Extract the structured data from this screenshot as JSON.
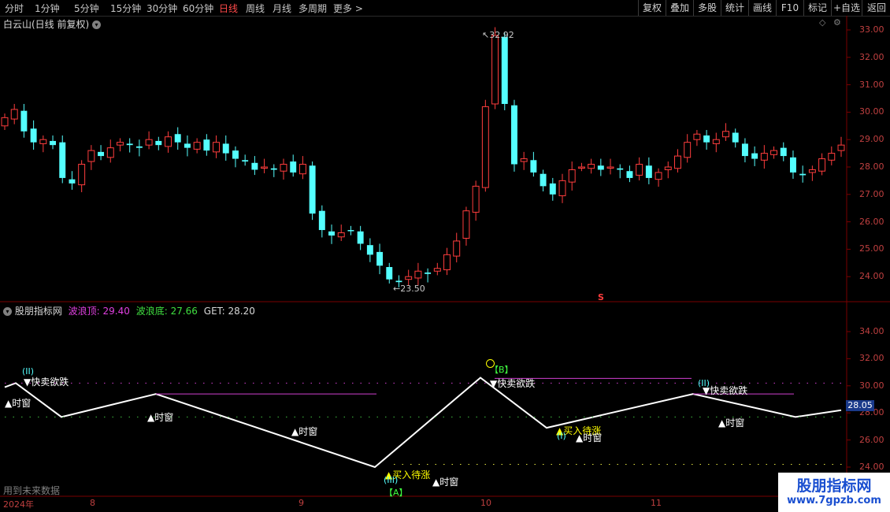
{
  "toolbar": {
    "periods": [
      "分时",
      "1分钟",
      "5分钟",
      "15分钟",
      "30分钟",
      "60分钟",
      "日线",
      "周线",
      "月线",
      "多周期",
      "更多 >"
    ],
    "active_period": "日线",
    "actions": [
      "复权",
      "叠加",
      "多股",
      "统计",
      "画线",
      "F10",
      "标记",
      "+自选",
      "返回"
    ]
  },
  "main_panel": {
    "stock_title": "白云山(日线 前复权)",
    "high_label": "32.92",
    "low_label": "23.50",
    "marker": "S",
    "y_ticks": [
      "33.00",
      "32.00",
      "31.00",
      "30.00",
      "29.00",
      "28.00",
      "27.00",
      "26.00",
      "25.00",
      "24.00"
    ]
  },
  "indicator_panel": {
    "name": "股朋指标网",
    "wave_top_label": "波浪顶: 29.40",
    "wave_bottom_label": "波浪底: 27.66",
    "get_label": "GET: 28.20",
    "y_ticks": [
      "34.00",
      "32.00",
      "30.00",
      "28.00",
      "26.00",
      "24.00"
    ],
    "current_value": "28.05",
    "footer_note": "用到未来数据",
    "annotations": {
      "sell_1": "▼快卖欲跌",
      "sell_2": "▼快卖欲跌",
      "sell_3": "▼快卖欲跌",
      "buy_1": "▲买入待涨",
      "buy_2": "▲买入待涨",
      "time_1": "▲时窗",
      "time_2": "▲时窗",
      "time_3": "▲时窗",
      "time_4": "▲时窗",
      "time_5": "▲时窗",
      "time_6": "▲时窗",
      "wave_ii_1": "(II)",
      "wave_ii_2": "(II)",
      "wave_iii": "(III)",
      "wave_i": "(I)",
      "box_a": "【A】",
      "box_b": "【B】"
    }
  },
  "date_axis": [
    "2024年",
    "8",
    "9",
    "10",
    "11"
  ],
  "watermark": {
    "title": "股朋指标网",
    "url": "www.7gpzb.com"
  },
  "colors": {
    "up": "#ff3d3d",
    "down": "#54ffff",
    "wave_line": "#ffffff",
    "magenta": "#d040d0",
    "yellow": "#ffff00",
    "grid_border": "#7a0000"
  }
}
